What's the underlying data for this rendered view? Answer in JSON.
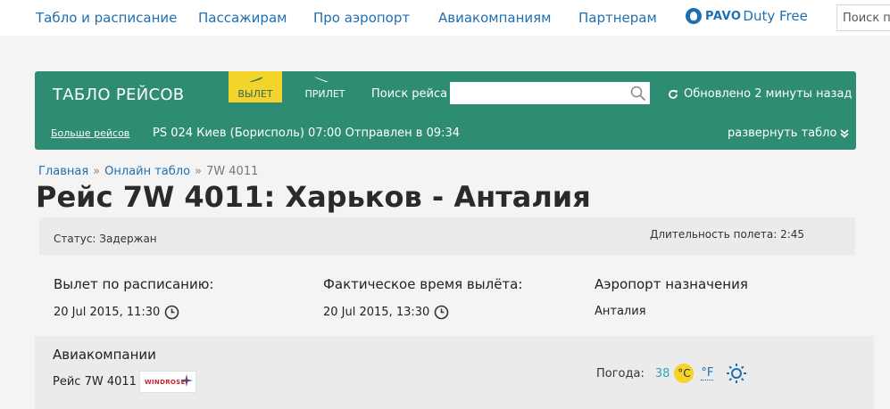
{
  "topnav": {
    "items": [
      "Табло и расписание",
      "Пассажирам",
      "Про аэропорт",
      "Авиакомпаниям",
      "Партнерам"
    ],
    "dutyfree_brand": "PAVO",
    "dutyfree_label": "Duty Free",
    "search_placeholder": "Поиск по"
  },
  "board": {
    "title": "ТАБЛО РЕЙСОВ",
    "tab_departure": "ВЫЛЕТ",
    "tab_arrival": "ПРИЛЕТ",
    "search_label": "Поиск рейса",
    "search_value": "",
    "updated": "Обновлено 2 минуты назад",
    "more_flights": "Больше рейсов",
    "ticker": "PS 024 Киев (Борисполь) 07:00 Отправлен в 09:34",
    "expand": "развернуть табло",
    "accent_color": "#2e8c72",
    "active_tab_color": "#f4d32a"
  },
  "breadcrumb": {
    "home": "Главная",
    "online": "Онлайн табло",
    "current": "7W 4011"
  },
  "page_title": "Рейс 7W 4011: Харьков - Анталия",
  "status": {
    "label": "Статус:",
    "value": "Задержан",
    "duration": "Длительность полета: 2:45"
  },
  "info": {
    "scheduled_label": "Вылет по расписанию:",
    "scheduled_value": "20 Jul 2015, 11:30",
    "actual_label": "Фактическое время вылёта:",
    "actual_value": "20 Jul 2015, 13:30",
    "destination_label": "Аэропорт назначения",
    "destination_value": "Анталия"
  },
  "airlines": {
    "heading": "Авиакомпании",
    "flight_label": "Рейс",
    "flight_value": "7W 4011",
    "logo_text": "WINDROSE"
  },
  "weather": {
    "label": "Погода:",
    "temp": "38",
    "celsius": "°C",
    "fahrenheit": "°F",
    "icon": "sun-icon"
  }
}
